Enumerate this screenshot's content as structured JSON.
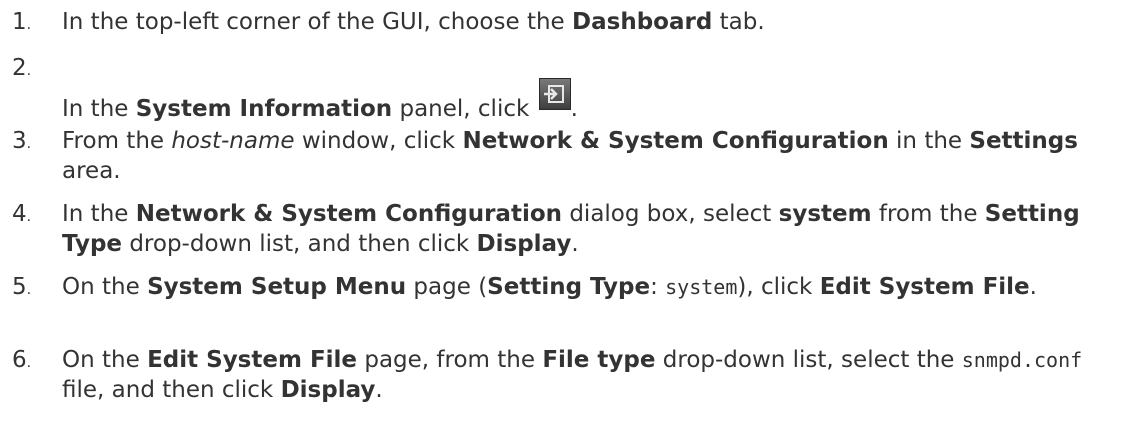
{
  "steps": [
    {
      "num": "1",
      "parts": {
        "t1": "In the top-left corner of the GUI, choose the ",
        "b1": "Dashboard",
        "t2": " tab."
      }
    },
    {
      "num": "2",
      "parts": {
        "t1": "In the ",
        "b1": "System Information",
        "t2": " panel, click ",
        "t3": "."
      },
      "icon": "import-config-icon"
    },
    {
      "num": "3",
      "parts": {
        "t1": "From the ",
        "i1": "host-name",
        "t2": " window, click ",
        "b1": "Network & System Configuration",
        "t3": " in the ",
        "b2": "Settings",
        "t4": " area."
      }
    },
    {
      "num": "4",
      "parts": {
        "t1": "In the ",
        "b1": "Network & System Configuration",
        "t2": " dialog box, select ",
        "b2": "system",
        "t3": " from the ",
        "b3": "Setting Type",
        "t4": " drop-down list, and then click ",
        "b4": "Display",
        "t5": "."
      }
    },
    {
      "num": "5",
      "parts": {
        "t1": "On the ",
        "b1": "System Setup Menu",
        "t2": " page (",
        "b2": "Setting Type",
        "t3": ": ",
        "c1": "system",
        "t4": "), click ",
        "b3": "Edit System File",
        "t5": "."
      }
    },
    {
      "num": "6",
      "parts": {
        "t1": "On the ",
        "b1": "Edit System File",
        "t2": " page, from the ",
        "b2": "File type",
        "t3": " drop-down list, select the ",
        "c1": "snmpd.conf",
        "t4": " file, and then click ",
        "b3": "Display",
        "t5": "."
      }
    }
  ]
}
